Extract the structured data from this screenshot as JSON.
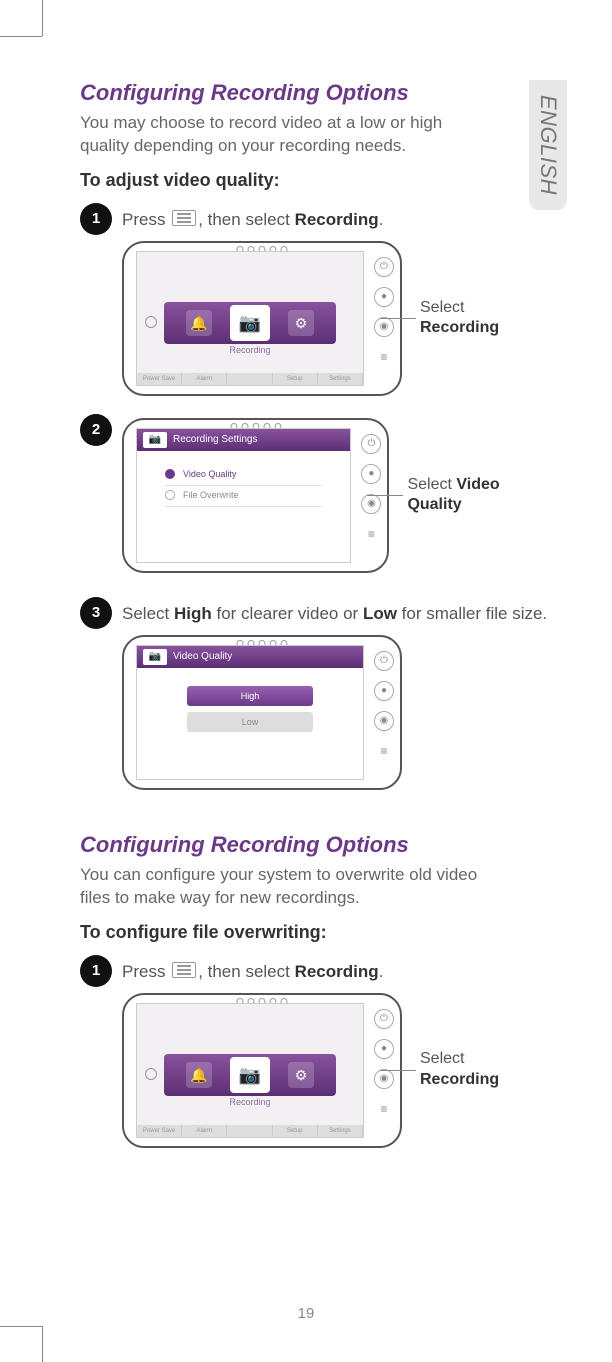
{
  "language_tab": "ENGLISH",
  "page_number": "19",
  "section1": {
    "title": "Configuring Recording Options",
    "intro": "You may choose to record video at a low or high quality depending on your recording needs.",
    "subhead": "To adjust video quality:",
    "steps": {
      "s1": {
        "num": "1",
        "pre": "Press ",
        "mid": ", then select ",
        "bold": "Recording",
        "post": "."
      },
      "s2": {
        "num": "2"
      },
      "s3": {
        "num": "3",
        "pre": "Select ",
        "b1": "High",
        "mid": " for clearer video or ",
        "b2": "Low",
        "post": " for smaller file size."
      }
    },
    "fig1": {
      "ribbon_label": "Recording",
      "tabs": [
        "Power Save",
        "Alarm",
        "",
        "Setup",
        "Settings"
      ],
      "callout_pre": "Select",
      "callout_bold": "Recording"
    },
    "fig2": {
      "header": "Recording Settings",
      "items": [
        "Video Quality",
        "File Overwrite"
      ],
      "callout_pre": "Select ",
      "callout_bold": "Video Quality"
    },
    "fig3": {
      "header": "Video Quality",
      "opt_high": "High",
      "opt_low": "Low"
    }
  },
  "section2": {
    "title": "Configuring Recording Options",
    "intro": "You can configure your system to overwrite old video files to make way for new recordings.",
    "subhead": "To configure file overwriting:",
    "steps": {
      "s1": {
        "num": "1",
        "pre": "Press ",
        "mid": ", then select ",
        "bold": "Recording",
        "post": "."
      }
    },
    "fig1": {
      "ribbon_label": "Recording",
      "tabs": [
        "Power Save",
        "Alarm",
        "",
        "Setup",
        "Settings"
      ],
      "callout_pre": "Select",
      "callout_bold": "Recording"
    }
  }
}
